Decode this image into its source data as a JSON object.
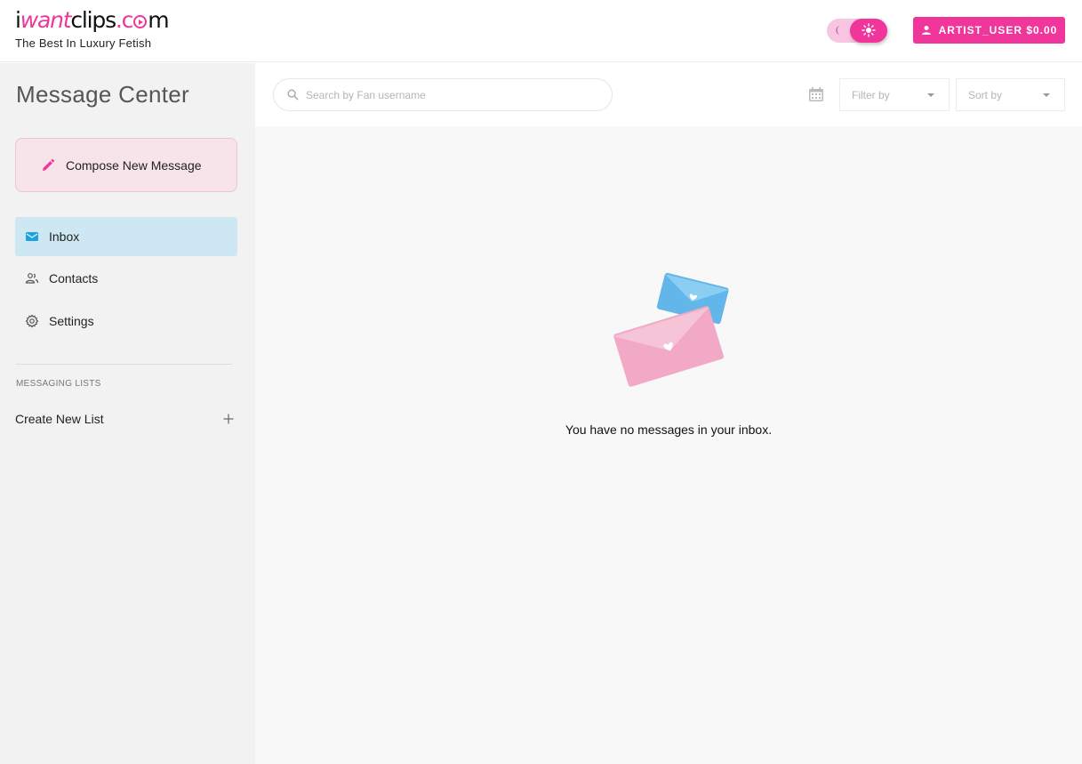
{
  "header": {
    "logo": {
      "part1": "i",
      "part2": "want",
      "part3": "clips",
      "part4": ".c",
      "part5": "m",
      "tagline": "The Best In Luxury Fetish"
    },
    "user_button_label": "ARTIST_USER $0.00",
    "accent_color": "#f0359b"
  },
  "sidebar": {
    "title": "Message Center",
    "compose_label": "Compose New Message",
    "nav": [
      {
        "label": "Inbox",
        "icon": "mail-icon",
        "active": true
      },
      {
        "label": "Contacts",
        "icon": "contacts-icon"
      },
      {
        "label": "Settings",
        "icon": "gear-icon"
      }
    ],
    "lists_heading": "MESSAGING LISTS",
    "create_list_label": "Create New List"
  },
  "toolbar": {
    "search_placeholder": "Search by Fan username",
    "filter_label": "Filter by",
    "sort_label": "Sort by"
  },
  "main": {
    "empty_message": "You have no messages in your inbox."
  }
}
